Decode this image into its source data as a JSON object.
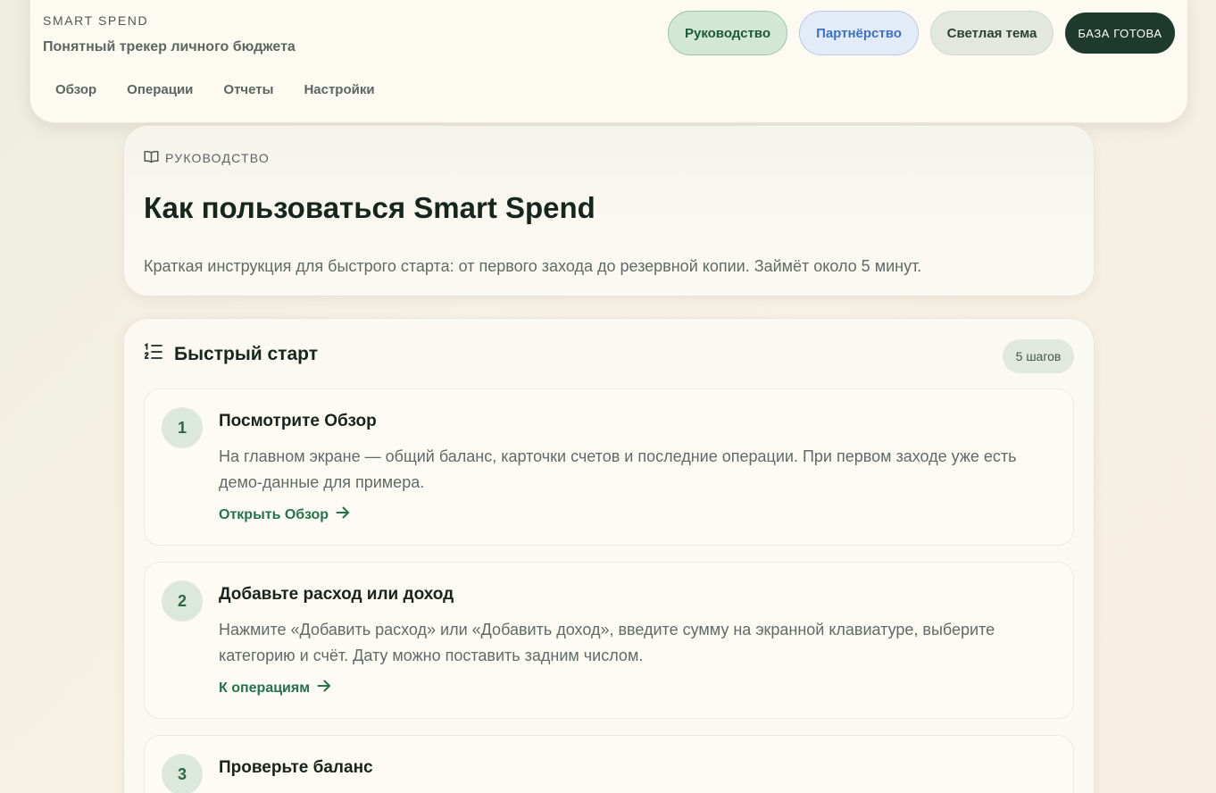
{
  "header": {
    "brand": "SMART SPEND",
    "tagline": "Понятный трекер личного бюджета",
    "nav": [
      "Обзор",
      "Операции",
      "Отчеты",
      "Настройки"
    ],
    "actions": {
      "guide": "Руководство",
      "partner": "Партнёрство",
      "theme": "Светлая тема",
      "db_status": "БАЗА ГОТОВА"
    }
  },
  "intro": {
    "kicker": "РУКОВОДСТВО",
    "kicker_icon": "book-icon",
    "title": "Как пользоваться Smart Spend",
    "description": "Краткая инструкция для быстрого старта: от первого захода до резервной копии. Займёт около 5 минут."
  },
  "quick_start": {
    "title": "Быстрый старт",
    "title_icon": "numbered-list-icon",
    "badge": "5 шагов",
    "steps": [
      {
        "number": "1",
        "title": "Посмотрите Обзор",
        "description": "На главном экране — общий баланс, карточки счетов и последние операции. При первом заходе уже есть демо-данные для примера.",
        "link": "Открыть Обзор"
      },
      {
        "number": "2",
        "title": "Добавьте расход или доход",
        "description": "Нажмите «Добавить расход» или «Добавить доход», введите сумму на экранной клавиатуре, выберите категорию и счёт. Дату можно поставить задним числом.",
        "link": "К операциям"
      },
      {
        "number": "3",
        "title": "Проверьте баланс"
      }
    ]
  },
  "colors": {
    "accent_green": "#23734a",
    "dark_badge": "#1e3a2c",
    "partner_blue": "#3a73c6"
  }
}
